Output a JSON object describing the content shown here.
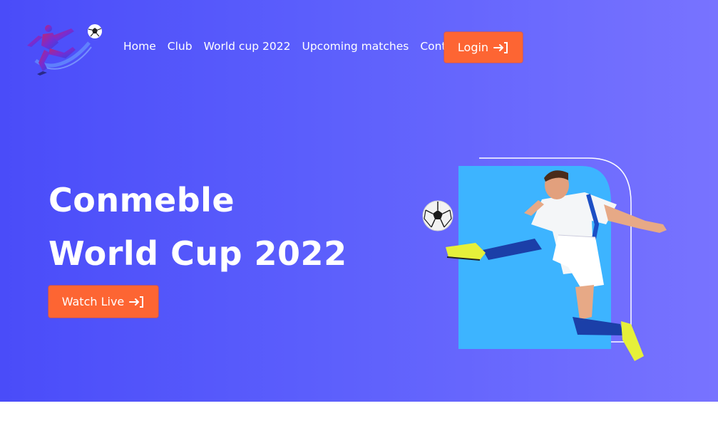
{
  "nav": {
    "items": [
      {
        "label": "Home"
      },
      {
        "label": "Club"
      },
      {
        "label": "World cup 2022"
      },
      {
        "label": "Upcoming matches"
      },
      {
        "label": "Contact"
      }
    ],
    "login_label": "Login"
  },
  "hero": {
    "title_line1": "Conmeble",
    "title_line2": "World Cup 2022",
    "watch_label": "Watch Live"
  },
  "colors": {
    "gradient_start": "#4a4cf9",
    "gradient_end": "#7873ff",
    "accent_button": "#fd6533",
    "panel_blue": "#3db4ff"
  }
}
